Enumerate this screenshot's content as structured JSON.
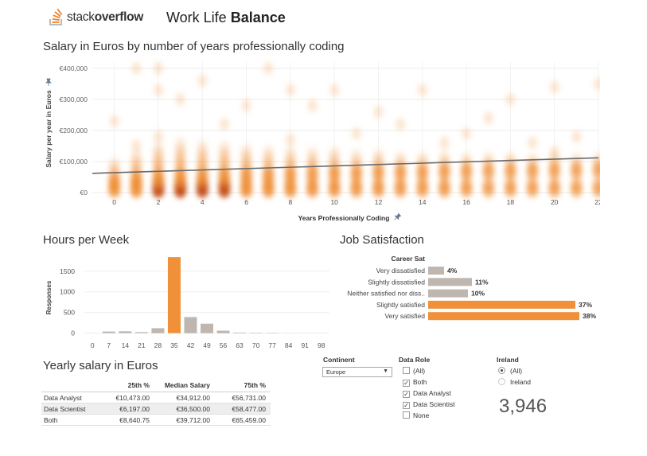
{
  "header": {
    "logo_prefix": "stack",
    "logo_suffix": "overflow",
    "title_prefix": "Work Life ",
    "title_bold": "Balance"
  },
  "scatter": {
    "title": "Salary in Euros by number of years professionally coding",
    "ylabel": "Salary per year in Euros",
    "xlabel": "Years Professionally Coding",
    "ytick_labels": [
      "€400,000",
      "€300,000",
      "€200,000",
      "€100,000",
      "€0"
    ],
    "xtick_labels": [
      "0",
      "2",
      "4",
      "6",
      "8",
      "10",
      "12",
      "14",
      "16",
      "18",
      "20",
      "22"
    ]
  },
  "hours": {
    "title": "Hours per Week",
    "ylabel": "Responses"
  },
  "job": {
    "title": "Job Satisfaction",
    "header": "Career Sat"
  },
  "salary": {
    "title": "Yearly salary in Euros",
    "columns": [
      "",
      "25th %",
      "Median Salary",
      "75th %"
    ],
    "rows": [
      [
        "Data Analyst",
        "€10,473.00",
        "€34,912.00",
        "€56,731.00"
      ],
      [
        "Data Scientist",
        "€6,197.00",
        "€36,500.00",
        "€58,477.00"
      ],
      [
        "Both",
        "€8,640.75",
        "€39,712.00",
        "€65,459.00"
      ]
    ]
  },
  "filters": {
    "continent": {
      "title": "Continent",
      "value": "Europe"
    },
    "data_role": {
      "title": "Data Role",
      "options": [
        {
          "label": "(All)",
          "checked": false
        },
        {
          "label": "Both",
          "checked": true
        },
        {
          "label": "Data Analyst",
          "checked": true
        },
        {
          "label": "Data Scientist",
          "checked": true
        },
        {
          "label": "None",
          "checked": false
        }
      ]
    },
    "ireland": {
      "title": "Ireland",
      "options": [
        {
          "label": "(All)",
          "selected": true
        },
        {
          "label": "Ireland",
          "selected": false
        }
      ],
      "count": "3,946"
    }
  },
  "colors": {
    "accent": "#f0913a",
    "neutral_bar": "#bfb6b0",
    "trend_line": "#6b6b6b",
    "blob_dark": "#c4501a"
  },
  "chart_data": [
    {
      "type": "scatter",
      "chart_title": "Salary in Euros by number of years professionally coding",
      "xlabel": "Years Professionally Coding",
      "ylabel": "Salary per year in Euros",
      "xlim": [
        -1,
        22
      ],
      "ylim": [
        0,
        420000
      ],
      "xticks": [
        0,
        2,
        4,
        6,
        8,
        10,
        12,
        14,
        16,
        18,
        20,
        22
      ],
      "yticks": [
        0,
        100000,
        200000,
        300000,
        400000
      ],
      "grid": true,
      "density_columns": [
        {
          "x": 0,
          "median": 25000,
          "spread": 70000,
          "density": 0.55
        },
        {
          "x": 1,
          "median": 30000,
          "spread": 90000,
          "density": 0.75
        },
        {
          "x": 2,
          "median": 35000,
          "spread": 110000,
          "density": 0.95
        },
        {
          "x": 3,
          "median": 38000,
          "spread": 120000,
          "density": 1.0
        },
        {
          "x": 4,
          "median": 40000,
          "spread": 110000,
          "density": 0.9
        },
        {
          "x": 5,
          "median": 42000,
          "spread": 105000,
          "density": 0.85
        },
        {
          "x": 6,
          "median": 45000,
          "spread": 95000,
          "density": 0.7
        },
        {
          "x": 7,
          "median": 45000,
          "spread": 90000,
          "density": 0.6
        },
        {
          "x": 8,
          "median": 48000,
          "spread": 85000,
          "density": 0.55
        },
        {
          "x": 9,
          "median": 50000,
          "spread": 80000,
          "density": 0.45
        },
        {
          "x": 10,
          "median": 52000,
          "spread": 80000,
          "density": 0.45
        },
        {
          "x": 11,
          "median": 52000,
          "spread": 70000,
          "density": 0.35
        },
        {
          "x": 12,
          "median": 55000,
          "spread": 70000,
          "density": 0.35
        },
        {
          "x": 13,
          "median": 55000,
          "spread": 60000,
          "density": 0.3
        },
        {
          "x": 14,
          "median": 55000,
          "spread": 60000,
          "density": 0.28
        },
        {
          "x": 15,
          "median": 58000,
          "spread": 60000,
          "density": 0.28
        },
        {
          "x": 16,
          "median": 58000,
          "spread": 55000,
          "density": 0.24
        },
        {
          "x": 17,
          "median": 60000,
          "spread": 55000,
          "density": 0.2
        },
        {
          "x": 18,
          "median": 60000,
          "spread": 55000,
          "density": 0.22
        },
        {
          "x": 19,
          "median": 60000,
          "spread": 50000,
          "density": 0.2
        },
        {
          "x": 20,
          "median": 62000,
          "spread": 55000,
          "density": 0.22
        },
        {
          "x": 21,
          "median": 62000,
          "spread": 50000,
          "density": 0.16
        },
        {
          "x": 22,
          "median": 64000,
          "spread": 50000,
          "density": 0.16
        }
      ],
      "outliers": [
        [
          0,
          230000
        ],
        [
          1,
          150000
        ],
        [
          1,
          400000
        ],
        [
          2,
          180000
        ],
        [
          2,
          400000
        ],
        [
          2,
          330000
        ],
        [
          3,
          300000
        ],
        [
          4,
          360000
        ],
        [
          5,
          220000
        ],
        [
          6,
          280000
        ],
        [
          7,
          400000
        ],
        [
          8,
          170000
        ],
        [
          8,
          330000
        ],
        [
          9,
          280000
        ],
        [
          10,
          330000
        ],
        [
          11,
          190000
        ],
        [
          12,
          260000
        ],
        [
          13,
          220000
        ],
        [
          14,
          330000
        ],
        [
          15,
          160000
        ],
        [
          16,
          190000
        ],
        [
          17,
          240000
        ],
        [
          18,
          300000
        ],
        [
          19,
          160000
        ],
        [
          20,
          340000
        ],
        [
          20,
          130000
        ],
        [
          21,
          180000
        ],
        [
          22,
          350000
        ]
      ],
      "trend_line": {
        "x": [
          -1,
          22
        ],
        "y": [
          62000,
          112000
        ]
      }
    },
    {
      "type": "bar",
      "chart_title": "Hours per Week",
      "ylabel": "Responses",
      "categories": [
        "0",
        "7",
        "14",
        "21",
        "28",
        "35",
        "42",
        "49",
        "56",
        "63",
        "70",
        "77",
        "84",
        "91",
        "98"
      ],
      "values": [
        0,
        40,
        45,
        25,
        120,
        1840,
        390,
        230,
        60,
        15,
        10,
        8,
        3,
        2,
        2
      ],
      "highlight": [
        "35"
      ],
      "ylim": [
        -180,
        1900
      ],
      "yticks": [
        0,
        500,
        1000,
        1500
      ]
    },
    {
      "type": "bar",
      "orientation": "horizontal",
      "chart_title": "Job Satisfaction",
      "categories_header": "Career Sat",
      "categories": [
        "Very dissatisfied",
        "Slightly dissatisfied",
        "Neither satisfied nor diss..",
        "Slightly satisfied",
        "Very satisfied"
      ],
      "values": [
        4,
        11,
        10,
        37,
        38
      ],
      "data_labels": [
        "4%",
        "11%",
        "10%",
        "37%",
        "38%"
      ],
      "highlight": [
        "Slightly satisfied",
        "Very satisfied"
      ],
      "xlim": [
        0,
        40
      ]
    }
  ]
}
